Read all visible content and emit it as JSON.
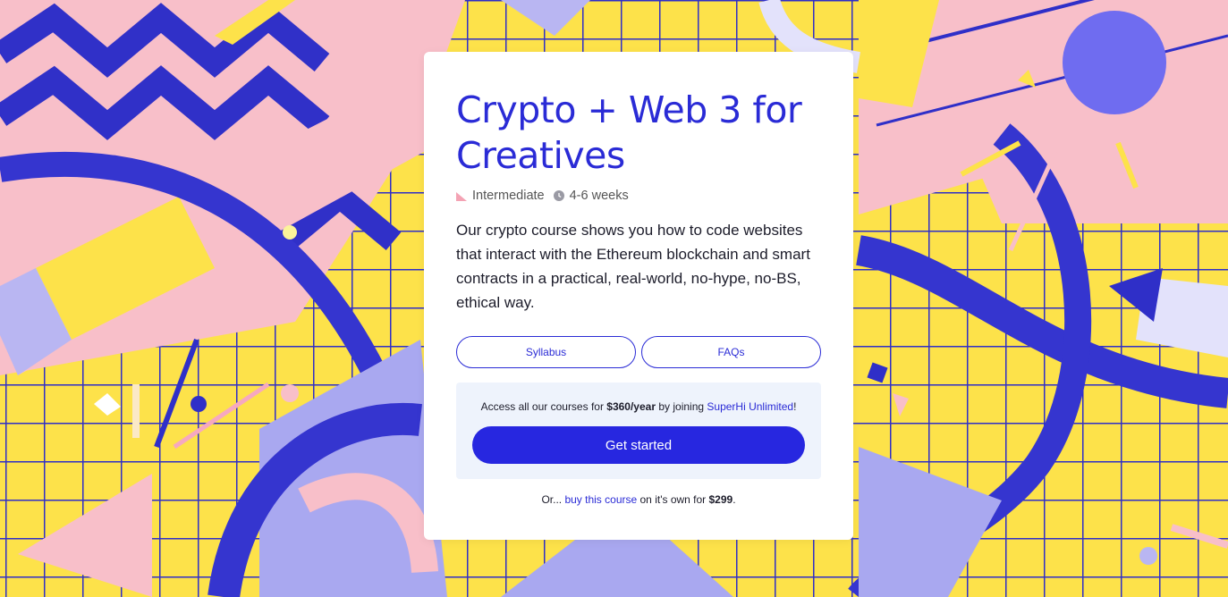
{
  "colors": {
    "brand_blue": "#2a2bd6",
    "yellow": "#fde24a",
    "pink": "#f8bfc9",
    "lavender": "#a9a8f0",
    "promo_bg": "#eef3fc"
  },
  "course": {
    "title_line1": "Crypto + Web 3 for",
    "title_line2": "Creatives",
    "level": "Intermediate",
    "duration": "4-6 weeks",
    "description": "Our crypto course shows you how to code websites that interact with the Ethereum blockchain and smart contracts in a practical, real-world, no-hype, no-BS, ethical way.",
    "level_icon": "level-bars-icon",
    "duration_icon": "clock-icon"
  },
  "buttons": {
    "syllabus": "Syllabus",
    "faqs": "FAQs"
  },
  "promo": {
    "text_before": "Access all our courses for ",
    "price": "$360/year",
    "text_middle": " by joining ",
    "link": "SuperHi Unlimited",
    "text_after": "!",
    "cta": "Get started"
  },
  "footer": {
    "prefix": "Or... ",
    "link": "buy this course",
    "middle": " on it's own for ",
    "price": "$299",
    "suffix": "."
  }
}
